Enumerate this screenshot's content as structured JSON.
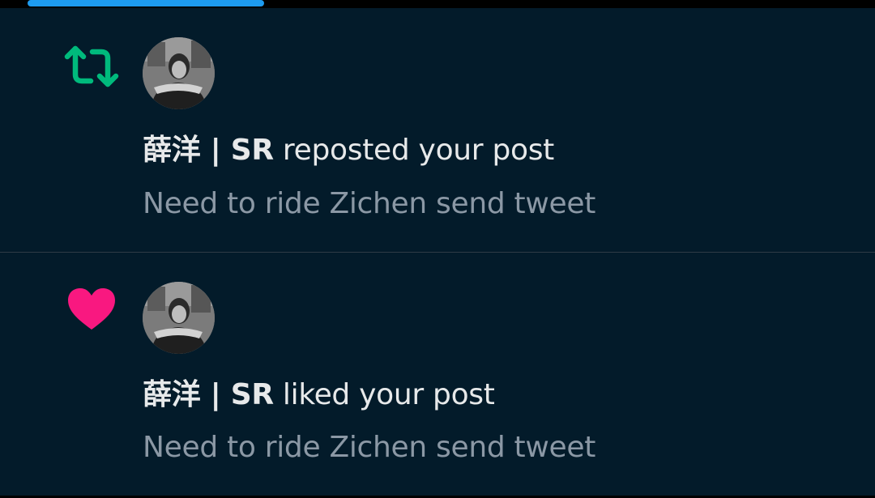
{
  "header": {
    "accent_color": "#1d9bf0"
  },
  "notifications": [
    {
      "type": "repost",
      "icon": "repost-icon",
      "icon_color": "#00ba7c",
      "user": "薛洋 | SR",
      "action": " reposted your post",
      "post_text": "Need to ride Zichen send tweet"
    },
    {
      "type": "like",
      "icon": "heart-icon",
      "icon_color": "#f91880",
      "user": "薛洋 | SR",
      "action": " liked your post",
      "post_text": "Need to ride Zichen send tweet"
    }
  ]
}
